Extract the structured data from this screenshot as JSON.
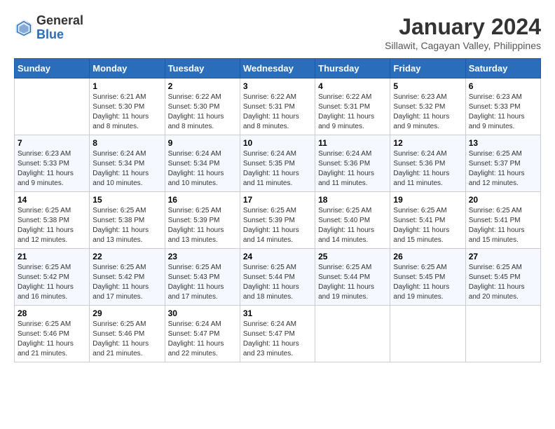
{
  "logo": {
    "line1": "General",
    "line2": "Blue"
  },
  "header": {
    "month": "January 2024",
    "location": "Sillawit, Cagayan Valley, Philippines"
  },
  "weekdays": [
    "Sunday",
    "Monday",
    "Tuesday",
    "Wednesday",
    "Thursday",
    "Friday",
    "Saturday"
  ],
  "weeks": [
    [
      {
        "day": "",
        "sunrise": "",
        "sunset": "",
        "daylight": ""
      },
      {
        "day": "1",
        "sunrise": "Sunrise: 6:21 AM",
        "sunset": "Sunset: 5:30 PM",
        "daylight": "Daylight: 11 hours and 8 minutes."
      },
      {
        "day": "2",
        "sunrise": "Sunrise: 6:22 AM",
        "sunset": "Sunset: 5:30 PM",
        "daylight": "Daylight: 11 hours and 8 minutes."
      },
      {
        "day": "3",
        "sunrise": "Sunrise: 6:22 AM",
        "sunset": "Sunset: 5:31 PM",
        "daylight": "Daylight: 11 hours and 8 minutes."
      },
      {
        "day": "4",
        "sunrise": "Sunrise: 6:22 AM",
        "sunset": "Sunset: 5:31 PM",
        "daylight": "Daylight: 11 hours and 9 minutes."
      },
      {
        "day": "5",
        "sunrise": "Sunrise: 6:23 AM",
        "sunset": "Sunset: 5:32 PM",
        "daylight": "Daylight: 11 hours and 9 minutes."
      },
      {
        "day": "6",
        "sunrise": "Sunrise: 6:23 AM",
        "sunset": "Sunset: 5:33 PM",
        "daylight": "Daylight: 11 hours and 9 minutes."
      }
    ],
    [
      {
        "day": "7",
        "sunrise": "Sunrise: 6:23 AM",
        "sunset": "Sunset: 5:33 PM",
        "daylight": "Daylight: 11 hours and 9 minutes."
      },
      {
        "day": "8",
        "sunrise": "Sunrise: 6:24 AM",
        "sunset": "Sunset: 5:34 PM",
        "daylight": "Daylight: 11 hours and 10 minutes."
      },
      {
        "day": "9",
        "sunrise": "Sunrise: 6:24 AM",
        "sunset": "Sunset: 5:34 PM",
        "daylight": "Daylight: 11 hours and 10 minutes."
      },
      {
        "day": "10",
        "sunrise": "Sunrise: 6:24 AM",
        "sunset": "Sunset: 5:35 PM",
        "daylight": "Daylight: 11 hours and 11 minutes."
      },
      {
        "day": "11",
        "sunrise": "Sunrise: 6:24 AM",
        "sunset": "Sunset: 5:36 PM",
        "daylight": "Daylight: 11 hours and 11 minutes."
      },
      {
        "day": "12",
        "sunrise": "Sunrise: 6:24 AM",
        "sunset": "Sunset: 5:36 PM",
        "daylight": "Daylight: 11 hours and 11 minutes."
      },
      {
        "day": "13",
        "sunrise": "Sunrise: 6:25 AM",
        "sunset": "Sunset: 5:37 PM",
        "daylight": "Daylight: 11 hours and 12 minutes."
      }
    ],
    [
      {
        "day": "14",
        "sunrise": "Sunrise: 6:25 AM",
        "sunset": "Sunset: 5:38 PM",
        "daylight": "Daylight: 11 hours and 12 minutes."
      },
      {
        "day": "15",
        "sunrise": "Sunrise: 6:25 AM",
        "sunset": "Sunset: 5:38 PM",
        "daylight": "Daylight: 11 hours and 13 minutes."
      },
      {
        "day": "16",
        "sunrise": "Sunrise: 6:25 AM",
        "sunset": "Sunset: 5:39 PM",
        "daylight": "Daylight: 11 hours and 13 minutes."
      },
      {
        "day": "17",
        "sunrise": "Sunrise: 6:25 AM",
        "sunset": "Sunset: 5:39 PM",
        "daylight": "Daylight: 11 hours and 14 minutes."
      },
      {
        "day": "18",
        "sunrise": "Sunrise: 6:25 AM",
        "sunset": "Sunset: 5:40 PM",
        "daylight": "Daylight: 11 hours and 14 minutes."
      },
      {
        "day": "19",
        "sunrise": "Sunrise: 6:25 AM",
        "sunset": "Sunset: 5:41 PM",
        "daylight": "Daylight: 11 hours and 15 minutes."
      },
      {
        "day": "20",
        "sunrise": "Sunrise: 6:25 AM",
        "sunset": "Sunset: 5:41 PM",
        "daylight": "Daylight: 11 hours and 15 minutes."
      }
    ],
    [
      {
        "day": "21",
        "sunrise": "Sunrise: 6:25 AM",
        "sunset": "Sunset: 5:42 PM",
        "daylight": "Daylight: 11 hours and 16 minutes."
      },
      {
        "day": "22",
        "sunrise": "Sunrise: 6:25 AM",
        "sunset": "Sunset: 5:42 PM",
        "daylight": "Daylight: 11 hours and 17 minutes."
      },
      {
        "day": "23",
        "sunrise": "Sunrise: 6:25 AM",
        "sunset": "Sunset: 5:43 PM",
        "daylight": "Daylight: 11 hours and 17 minutes."
      },
      {
        "day": "24",
        "sunrise": "Sunrise: 6:25 AM",
        "sunset": "Sunset: 5:44 PM",
        "daylight": "Daylight: 11 hours and 18 minutes."
      },
      {
        "day": "25",
        "sunrise": "Sunrise: 6:25 AM",
        "sunset": "Sunset: 5:44 PM",
        "daylight": "Daylight: 11 hours and 19 minutes."
      },
      {
        "day": "26",
        "sunrise": "Sunrise: 6:25 AM",
        "sunset": "Sunset: 5:45 PM",
        "daylight": "Daylight: 11 hours and 19 minutes."
      },
      {
        "day": "27",
        "sunrise": "Sunrise: 6:25 AM",
        "sunset": "Sunset: 5:45 PM",
        "daylight": "Daylight: 11 hours and 20 minutes."
      }
    ],
    [
      {
        "day": "28",
        "sunrise": "Sunrise: 6:25 AM",
        "sunset": "Sunset: 5:46 PM",
        "daylight": "Daylight: 11 hours and 21 minutes."
      },
      {
        "day": "29",
        "sunrise": "Sunrise: 6:25 AM",
        "sunset": "Sunset: 5:46 PM",
        "daylight": "Daylight: 11 hours and 21 minutes."
      },
      {
        "day": "30",
        "sunrise": "Sunrise: 6:24 AM",
        "sunset": "Sunset: 5:47 PM",
        "daylight": "Daylight: 11 hours and 22 minutes."
      },
      {
        "day": "31",
        "sunrise": "Sunrise: 6:24 AM",
        "sunset": "Sunset: 5:47 PM",
        "daylight": "Daylight: 11 hours and 23 minutes."
      },
      {
        "day": "",
        "sunrise": "",
        "sunset": "",
        "daylight": ""
      },
      {
        "day": "",
        "sunrise": "",
        "sunset": "",
        "daylight": ""
      },
      {
        "day": "",
        "sunrise": "",
        "sunset": "",
        "daylight": ""
      }
    ]
  ]
}
